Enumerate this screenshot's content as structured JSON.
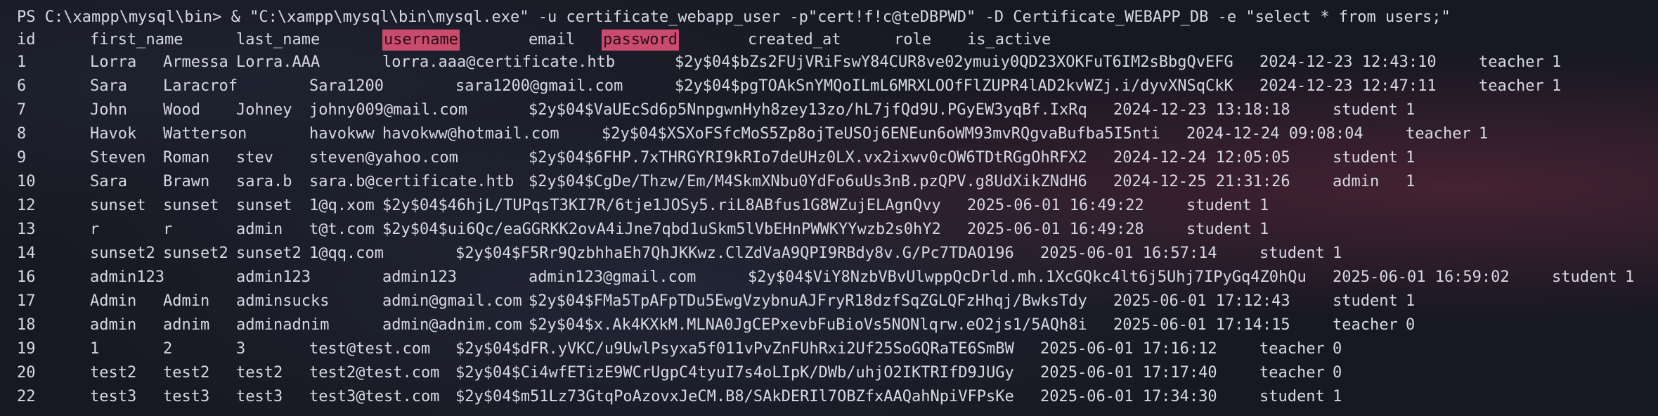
{
  "command": "PS C:\\xampp\\mysql\\bin> & \"C:\\xampp\\mysql\\bin\\mysql.exe\" -u certificate_webapp_user -p\"cert!f!c@teDBPWD\" -D Certificate_WEBAPP_DB -e \"select * from users;\"",
  "headers": {
    "id": "id",
    "first_name": "first_name",
    "last_name": "last_name",
    "username": "username",
    "email": "email",
    "password": "password",
    "created_at": "created_at",
    "role": "role",
    "is_active": "is_active"
  },
  "rows": [
    {
      "id": "1",
      "first_name": "Lorra",
      "last_name": "Armessa",
      "username": "Lorra.AAA",
      "email": "lorra.aaa@certificate.htb",
      "password": "$2y$04$bZs2FUjVRiFswY84CUR8ve02ymuiy0QD23XOKFuT6IM2sBbgQvEFG",
      "created_at": "2024-12-23 12:43:10",
      "role": "teacher",
      "is_active": "1"
    },
    {
      "id": "6",
      "first_name": "Sara",
      "last_name": "Laracrof",
      "username": "Sara1200",
      "email": "sara1200@gmail.com",
      "password": "$2y$04$pgTOAkSnYMQoILmL6MRXLOOfFlZUPR4lAD2kvWZj.i/dyvXNSqCkK",
      "created_at": "2024-12-23 12:47:11",
      "role": "teacher",
      "is_active": "1"
    },
    {
      "id": "7",
      "first_name": "John",
      "last_name": "Wood",
      "username": "Johney",
      "email": "johny009@mail.com",
      "password": "$2y$04$VaUEcSd6p5NnpgwnHyh8zey13zo/hL7jfQd9U.PGyEW3yqBf.IxRq",
      "created_at": "2024-12-23 13:18:18",
      "role": "student",
      "is_active": "1"
    },
    {
      "id": "8",
      "first_name": "Havok",
      "last_name": "Watterson",
      "username": "havokww",
      "email": "havokww@hotmail.com",
      "password": "$2y$04$XSXoFSfcMoS5Zp8ojTeUSOj6ENEun6oWM93mvRQgvaBufba5I5nti",
      "created_at": "2024-12-24 09:08:04",
      "role": "teacher",
      "is_active": "1"
    },
    {
      "id": "9",
      "first_name": "Steven",
      "last_name": "Roman",
      "username": "stev",
      "email": "steven@yahoo.com",
      "password": "$2y$04$6FHP.7xTHRGYRI9kRIo7deUHz0LX.vx2ixwv0cOW6TDtRGgOhRFX2",
      "created_at": "2024-12-24 12:05:05",
      "role": "student",
      "is_active": "1"
    },
    {
      "id": "10",
      "first_name": "Sara",
      "last_name": "Brawn",
      "username": "sara.b",
      "email": "sara.b@certificate.htb",
      "password": "$2y$04$CgDe/Thzw/Em/M4SkmXNbu0YdFo6uUs3nB.pzQPV.g8UdXikZNdH6",
      "created_at": "2024-12-25 21:31:26",
      "role": "admin",
      "is_active": "1"
    },
    {
      "id": "12",
      "first_name": "sunset",
      "last_name": "sunset",
      "username": "sunset",
      "email": "1@q.xom",
      "password": "$2y$04$46hjL/TUPqsT3KI7R/6tje1JOSy5.riL8ABfus1G8WZujELAgnQvy",
      "created_at": "2025-06-01 16:49:22",
      "role": "student",
      "is_active": "1"
    },
    {
      "id": "13",
      "first_name": "r",
      "last_name": "r",
      "username": "admin",
      "email": "t@t.com",
      "password": "$2y$04$ui6Qc/eaGGRKK2ovA4iJne7qbd1uSkm5lVbEHnPWWKYYwzb2s0hY2",
      "created_at": "2025-06-01 16:49:28",
      "role": "student",
      "is_active": "1"
    },
    {
      "id": "14",
      "first_name": "sunset2",
      "last_name": "sunset2",
      "username": "sunset2",
      "email": "1@qq.com",
      "password": "$2y$04$F5Rr9QzbhhaEh7QhJKKwz.ClZdVaA9QPI9RBdy8v.G/Pc7TDAO196",
      "created_at": "2025-06-01 16:57:14",
      "role": "student",
      "is_active": "1"
    },
    {
      "id": "16",
      "first_name": "admin123",
      "last_name": "admin123",
      "username": "admin123",
      "email": "admin123@gmail.com",
      "password": "$2y$04$ViY8NzbVBvUlwppQcDrld.mh.1XcGQkc4lt6j5Uhj7IPyGq4Z0hQu",
      "created_at": "2025-06-01 16:59:02",
      "role": "student",
      "is_active": "1"
    },
    {
      "id": "17",
      "first_name": "Admin",
      "last_name": "Admin",
      "username": "adminsucks",
      "email": "admin@gmail.com",
      "password": "$2y$04$FMa5TpAFpTDu5EwgVzybnuAJFryR18dzfSqZGLQFzHhqj/BwksTdy",
      "created_at": "2025-06-01 17:12:43",
      "role": "student",
      "is_active": "1"
    },
    {
      "id": "18",
      "first_name": "admin",
      "last_name": "adnim",
      "username": "adminadnim",
      "email": "admin@adnim.com",
      "password": "$2y$04$x.Ak4KXkM.MLNA0JgCEPxevbFuBioVs5NONlqrw.eO2js1/5AQh8i",
      "created_at": "2025-06-01 17:14:15",
      "role": "teacher",
      "is_active": "0"
    },
    {
      "id": "19",
      "first_name": "1",
      "last_name": "2",
      "username": "3",
      "email": "test@test.com",
      "password": "$2y$04$dFR.yVKC/u9UwlPsyxa5f011vPvZnFUhRxi2Uf25SoGQRaTE6SmBW",
      "created_at": "2025-06-01 17:16:12",
      "role": "teacher",
      "is_active": "0"
    },
    {
      "id": "20",
      "first_name": "test2",
      "last_name": "test2",
      "username": "test2",
      "email": "test2@test.com",
      "password": "$2y$04$Ci4wfETizE9WCrUgpC4tyuI7s4oLIpK/DWb/uhjO2IKTRIfD9JUGy",
      "created_at": "2025-06-01 17:17:40",
      "role": "teacher",
      "is_active": "0"
    },
    {
      "id": "22",
      "first_name": "test3",
      "last_name": "test3",
      "username": "test3",
      "email": "test3@test.com",
      "password": "$2y$04$m51Lz73GtqPoAzovxJeCM.B8/SAkDERIl7OBZfxAAQahNpiVFPsKe",
      "created_at": "2025-06-01 17:34:30",
      "role": "student",
      "is_active": "1"
    }
  ],
  "highlight_color": "#c94c6d",
  "text_color": "#d6d8e4"
}
